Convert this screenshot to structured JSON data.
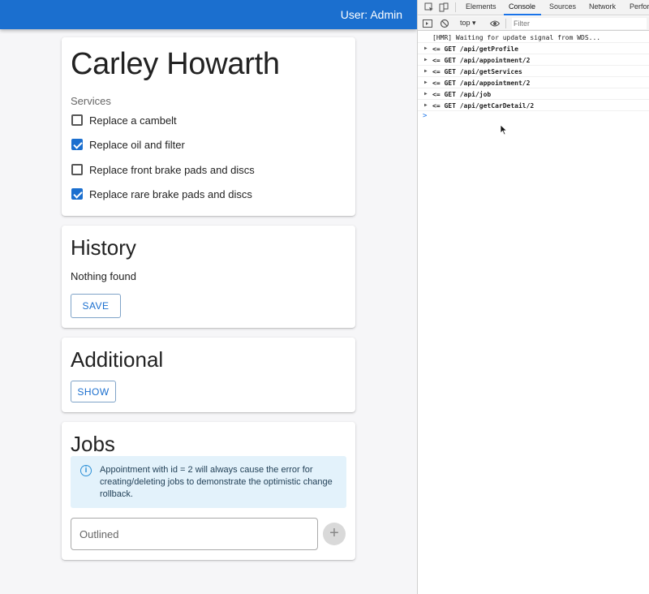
{
  "appbar": {
    "user_label": "User: Admin"
  },
  "profile": {
    "name": "Carley Howarth",
    "services_label": "Services",
    "services": [
      {
        "label": "Replace a cambelt",
        "checked": false
      },
      {
        "label": "Replace oil and filter",
        "checked": true
      },
      {
        "label": "Replace front brake pads and discs",
        "checked": false
      },
      {
        "label": "Replace rare brake pads and discs",
        "checked": true
      }
    ]
  },
  "history": {
    "title": "History",
    "empty_text": "Nothing found",
    "save_label": "SAVE"
  },
  "additional": {
    "title": "Additional",
    "show_label": "SHOW"
  },
  "jobs": {
    "title": "Jobs",
    "alert_text": "Appointment with id = 2 will always cause the error for creating/deleting jobs to demonstrate the optimistic change rollback.",
    "input_placeholder": "Outlined",
    "add_symbol": "+"
  },
  "devtools": {
    "tabs": [
      "Elements",
      "Console",
      "Sources",
      "Network",
      "Perfor"
    ],
    "active_tab": "Console",
    "context": "top",
    "filter_placeholder": "Filter",
    "console_lines": [
      {
        "text": "[HMR] Waiting for update signal from WDS...",
        "expandable": false
      },
      {
        "text": "<= GET /api/getProfile",
        "expandable": true
      },
      {
        "text": "<= GET /api/appointment/2",
        "expandable": true
      },
      {
        "text": "<= GET /api/getServices",
        "expandable": true
      },
      {
        "text": "<= GET /api/appointment/2",
        "expandable": true
      },
      {
        "text": "<= GET /api/job",
        "expandable": true
      },
      {
        "text": "<= GET /api/getCarDetail/2",
        "expandable": true
      }
    ],
    "prompt_symbol": ">"
  }
}
